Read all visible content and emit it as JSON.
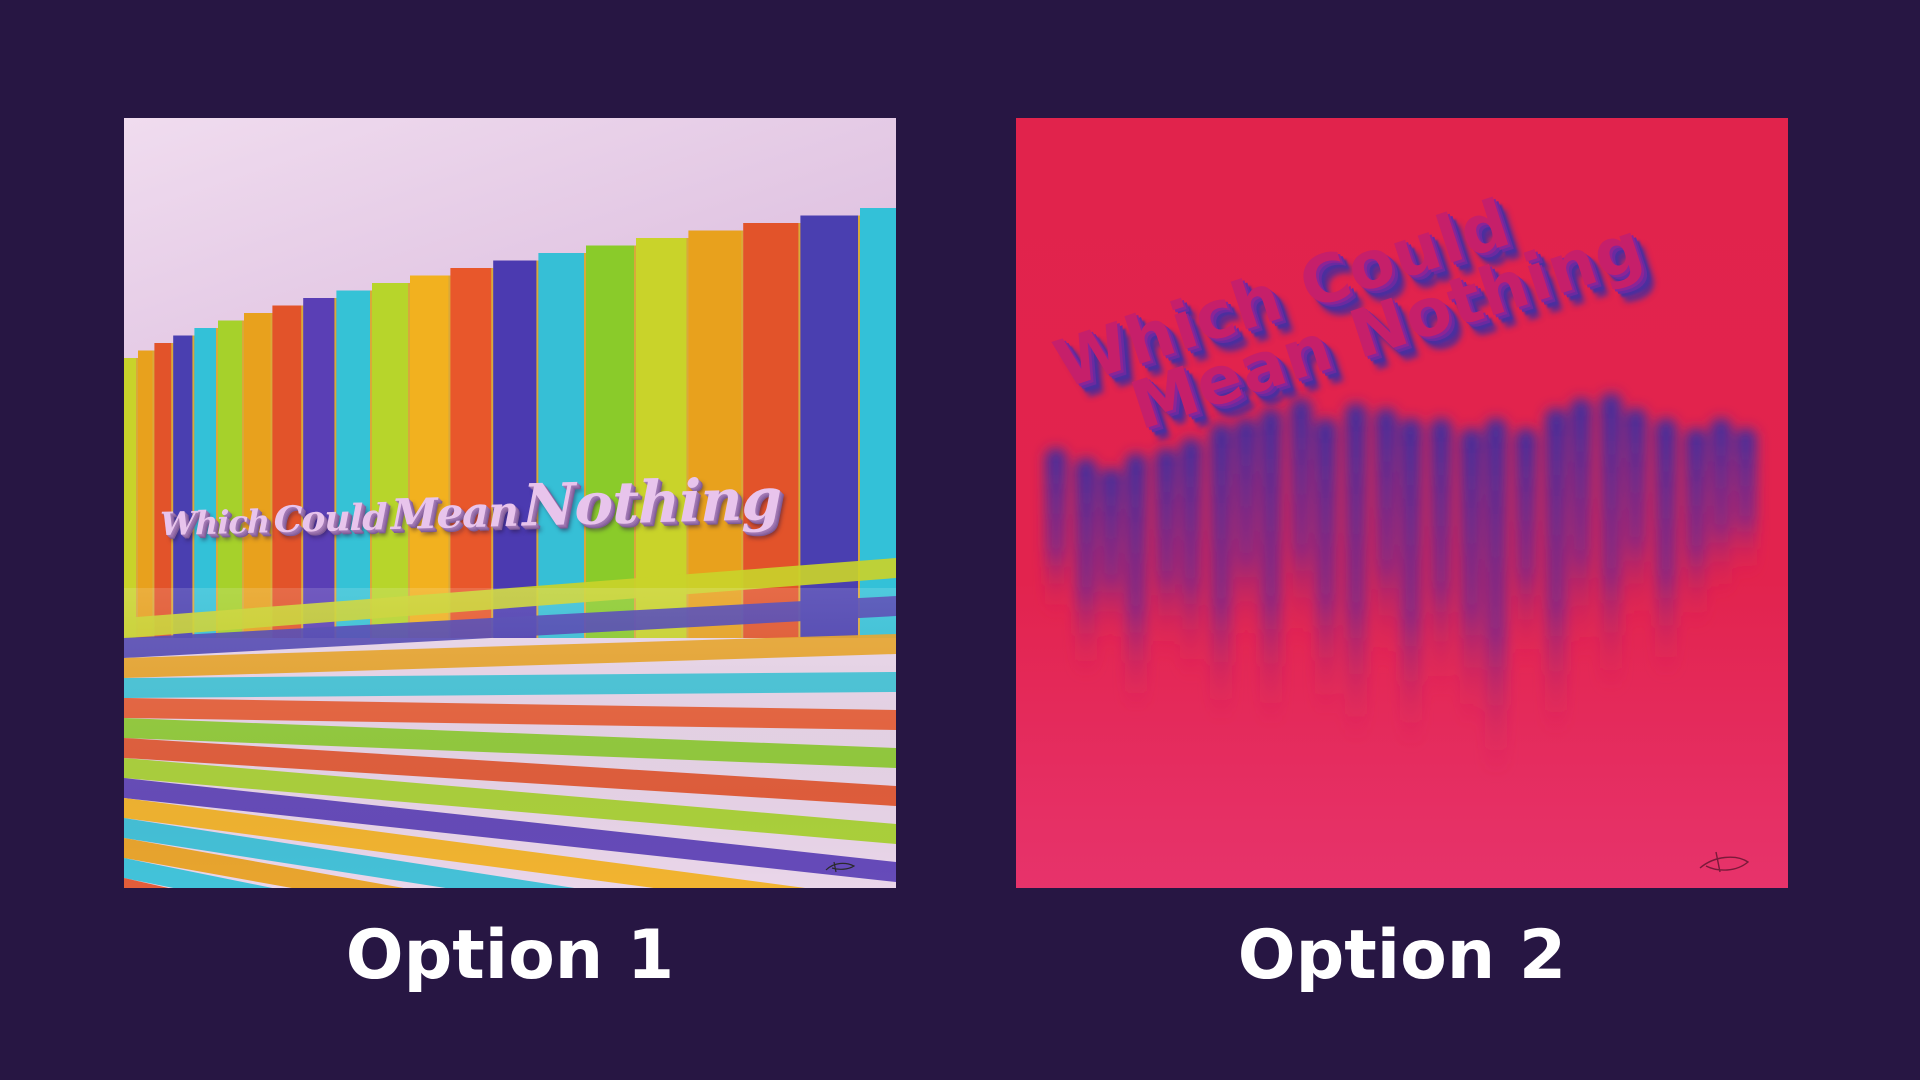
{
  "options": [
    {
      "caption": "Option 1",
      "art_title": [
        "Which",
        "Could",
        "Mean",
        "Nothing"
      ]
    },
    {
      "caption": "Option 2",
      "art_title_lines": [
        "Which Could",
        "Mean Nothing"
      ]
    }
  ],
  "colors": {
    "background": "#271643",
    "caption_text": "#ffffff",
    "option2_base": "#e1234c",
    "option2_drip": "#3b2fa0"
  }
}
